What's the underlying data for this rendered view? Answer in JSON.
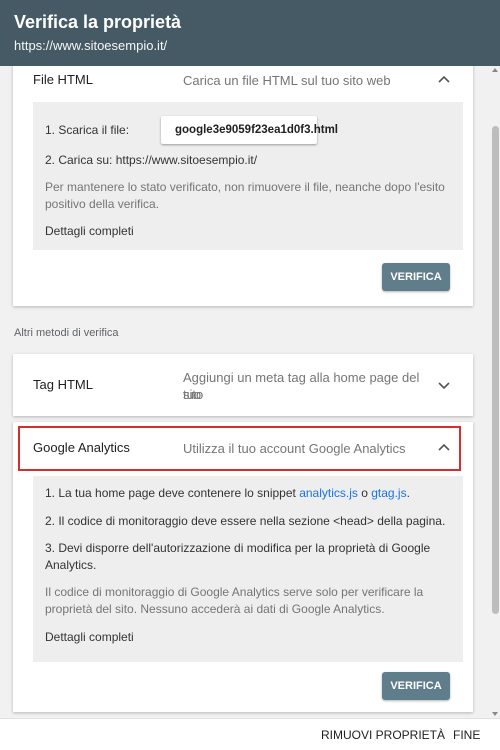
{
  "header": {
    "title": "Verifica la proprietà",
    "subtitle": "https://www.sitoesempio.it/"
  },
  "file_html": {
    "name": "File HTML",
    "description": "Carica un file HTML sul tuo sito web",
    "step1_label": "1. Scarica il file:",
    "download_filename": "google3e9059f23ea1d0f3.html",
    "step2": "2. Carica su: https://www.sitoesempio.it/",
    "note_line1": "Per mantenere lo stato verificato, non rimuovere il file, neanche dopo l'esito",
    "note_line2": "positivo della verifica.",
    "details_link": "Dettagli completi",
    "verify_label": "VERIFICA"
  },
  "other_methods_label": "Altri metodi di verifica",
  "tag_html": {
    "name": "Tag HTML",
    "description_line1": "Aggiungi un meta tag alla home page del tuo",
    "description_line2": "sito"
  },
  "google_analytics": {
    "name": "Google Analytics",
    "description": "Utilizza il tuo account Google Analytics",
    "step1_prefix": "1. La tua home page deve contenere lo snippet ",
    "step1_link1": "analytics.js",
    "step1_middle": " o ",
    "step1_link2": "gtag.js",
    "step1_suffix": ".",
    "step2": "2. Il codice di monitoraggio deve essere nella sezione <head> della pagina.",
    "step3_line1": "3. Devi disporre dell'autorizzazione di modifica per la proprietà di Google",
    "step3_line2": "Analytics.",
    "note_line1": "Il codice di monitoraggio di Google Analytics serve solo per verificare la",
    "note_line2": "proprietà del sito. Nessuno accederà ai dati di Google Analytics.",
    "details_link": "Dettagli completi",
    "verify_label": "VERIFICA"
  },
  "footer": {
    "remove_label": "RIMUOVI PROPRIETÀ",
    "done_label": "FINE"
  },
  "colors": {
    "header_bg": "#455a64",
    "verify_button": "#607d8b",
    "link": "#1a73e8",
    "highlight": "#d32f2f"
  },
  "icons": {
    "download": "download-icon",
    "chevron_up": "chevron-up-icon",
    "chevron_down": "chevron-down-icon"
  }
}
